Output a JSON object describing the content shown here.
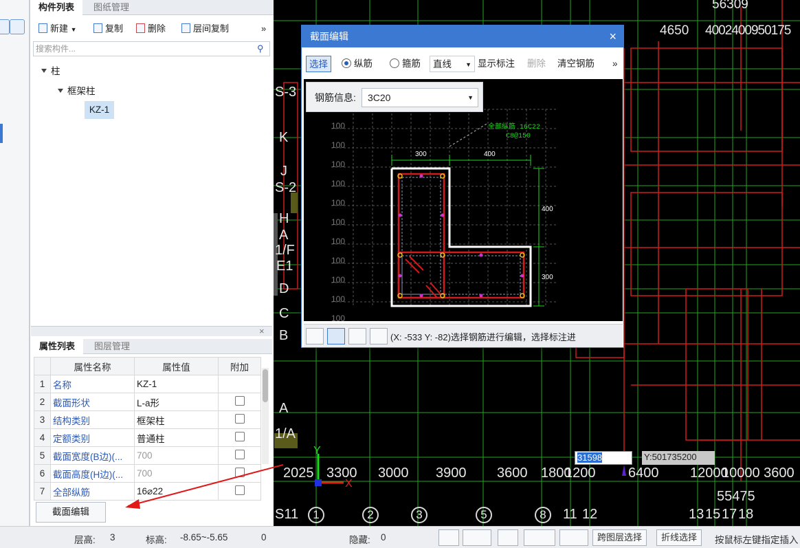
{
  "left_panel": {
    "tabs": [
      "构件列表",
      "图纸管理"
    ],
    "toolbar": {
      "new": "新建",
      "copy": "复制",
      "delete": "删除",
      "floor_copy": "层间复制",
      "more": "»"
    },
    "search_placeholder": "搜索构件...",
    "tree": {
      "root": "柱",
      "child": "框架柱",
      "leaf": "KZ-1"
    }
  },
  "prop_panel": {
    "tabs": [
      "属性列表",
      "图层管理"
    ],
    "headers": [
      "属性名称",
      "属性值",
      "附加"
    ],
    "rows": [
      {
        "n": "1",
        "name": "名称",
        "value": "KZ-1"
      },
      {
        "n": "2",
        "name": "截面形状",
        "value": "L-a形"
      },
      {
        "n": "3",
        "name": "结构类别",
        "value": "框架柱"
      },
      {
        "n": "4",
        "name": "定额类别",
        "value": "普通柱"
      },
      {
        "n": "5",
        "name": "截面宽度(B边)(...",
        "value": "700"
      },
      {
        "n": "6",
        "name": "截面高度(H边)(...",
        "value": "700"
      },
      {
        "n": "7",
        "name": "全部纵筋",
        "value": "16⌀22"
      }
    ],
    "edit_button": "截面编辑"
  },
  "dialog": {
    "title": "截面编辑",
    "close": "×",
    "toolbar": {
      "select": "选择",
      "longitudinal": "纵筋",
      "stirrup": "箍筋",
      "line_type": "直线",
      "show_annotation": "显示标注",
      "delete": "删除",
      "clear_rebar": "清空钢筋",
      "more": "»"
    },
    "rebar_info_label": "钢筋信息:",
    "rebar_info_value": "3C20",
    "drawing": {
      "note_all": "全部纵筋 16C22",
      "note_stirrup": "C8@150",
      "dim_top_left": "300",
      "dim_top_right": "400",
      "dim_right_top": "400",
      "dim_right_bottom": "300",
      "grid_labels": [
        "100",
        "100",
        "100",
        "100",
        "100",
        "100",
        "100",
        "100",
        "100",
        "100",
        "100"
      ]
    },
    "status": "(X: -533 Y: -82)选择钢筋进行编辑，选择标注进"
  },
  "cad": {
    "top_numbers": [
      "56309",
      "4650",
      "4002400950175"
    ],
    "left_axes": [
      "S-3",
      "K",
      "J",
      "S-2",
      "H",
      "A",
      "1/F",
      "E1",
      "D",
      "C",
      "B",
      "A",
      "1/A"
    ],
    "bottom_dims": [
      "2025",
      "3300",
      "3000",
      "3900",
      "3600",
      "1800",
      "1200",
      "6400",
      "12000",
      "10000 3600"
    ],
    "total_dim": "55475",
    "bottom_axes": [
      "S11",
      "1",
      "2",
      "3",
      "5",
      "8",
      "11",
      "12",
      "13",
      "15",
      "17",
      "18"
    ],
    "coord_x": "31598",
    "coord_y": "Y:501735200"
  },
  "status_bar": {
    "floor_height_label": "层高:",
    "floor_height": "3",
    "elevation_label": "标高:",
    "elevation": "-8.65~-5.65",
    "zero": "0",
    "hidden_label": "隐藏:",
    "hidden": "0",
    "cross_layer": "跨图层选择",
    "polyline_select": "折线选择",
    "hint": "按鼠标左键指定插入"
  }
}
